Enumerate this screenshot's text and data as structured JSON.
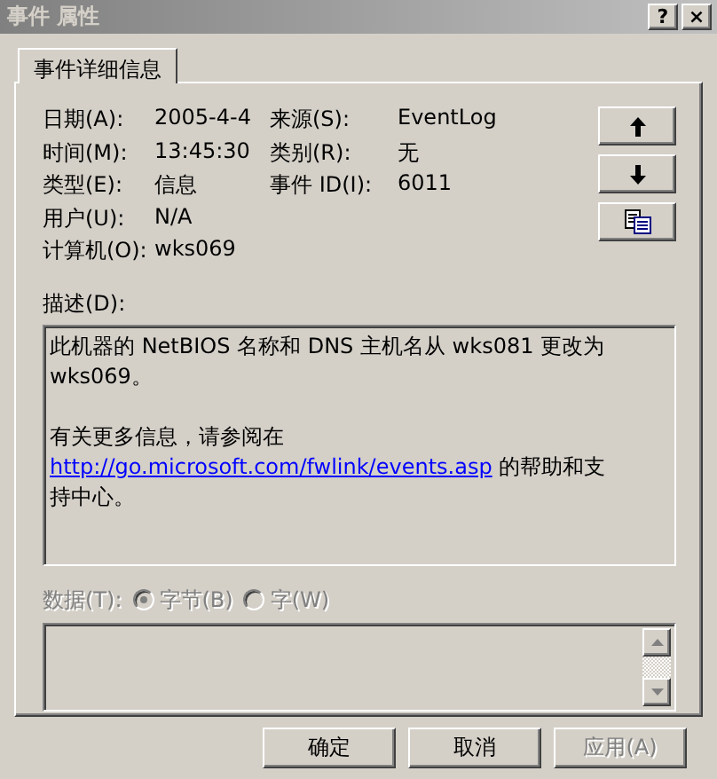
{
  "window": {
    "title": "事件 属性",
    "title_buttons": [
      "?",
      "×"
    ],
    "active": false
  },
  "tabs": [
    {
      "label": "事件详细信息",
      "selected": true
    }
  ],
  "left_fields": [
    {
      "label": "日期(A):",
      "value": "2005-4-4"
    },
    {
      "label": "时间(M):",
      "value": "13:45:30"
    },
    {
      "label": "类型(E):",
      "value": "信息"
    },
    {
      "label": "用户(U):",
      "value": "N/A"
    },
    {
      "label": "计算机(O):",
      "value": "wks069"
    }
  ],
  "right_fields": [
    {
      "label": "来源(S):",
      "value": "EventLog"
    },
    {
      "label": "类别(R):",
      "value": "无"
    },
    {
      "label": "事件 ID(I):",
      "value": "6011"
    }
  ],
  "side_buttons": [
    {
      "kind": "up"
    },
    {
      "kind": "down"
    },
    {
      "kind": "copy"
    }
  ],
  "description": {
    "label": "描述(D):",
    "paragraphs": [
      {
        "text": "此机器的 NetBIOS 名称和 DNS 主机名从 wks081 更改为 wks069。"
      },
      {
        "text": "有关更多信息，请参阅在",
        "link": "http://go.microsoft.com/fwlink/events.asp",
        "after": " 的帮助和支持中心。"
      }
    ]
  },
  "data": {
    "label": "数据(T):",
    "disabled": true,
    "options": [
      {
        "label": "字节(B)",
        "selected": true
      },
      {
        "label": "字(W)",
        "selected": false
      }
    ]
  },
  "buttons": [
    {
      "label": "确定",
      "disabled": false
    },
    {
      "label": "取消",
      "disabled": false
    },
    {
      "label": "应用(A)",
      "disabled": true
    }
  ]
}
